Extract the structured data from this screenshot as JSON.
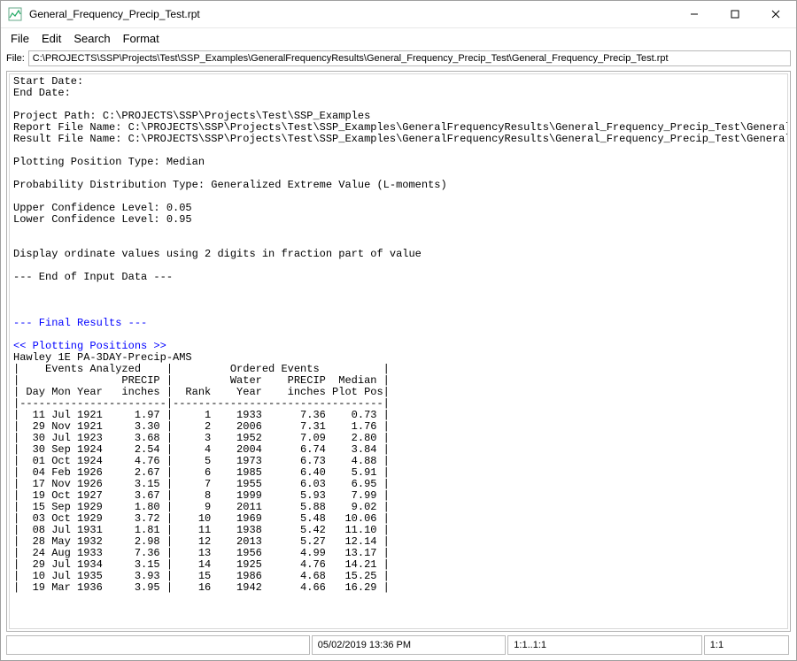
{
  "window": {
    "title": "General_Frequency_Precip_Test.rpt"
  },
  "menu": {
    "file": "File",
    "edit": "Edit",
    "search": "Search",
    "format": "Format"
  },
  "file_row": {
    "label": "File:",
    "path": "C:\\PROJECTS\\SSP\\Projects\\Test\\SSP_Examples\\GeneralFrequencyResults\\General_Frequency_Precip_Test\\General_Frequency_Precip_Test.rpt"
  },
  "report": {
    "start_date_label": "Start Date:",
    "end_date_label": "End Date:",
    "project_path_line": "Project Path: C:\\PROJECTS\\SSP\\Projects\\Test\\SSP_Examples",
    "report_file_line": "Report File Name: C:\\PROJECTS\\SSP\\Projects\\Test\\SSP_Examples\\GeneralFrequencyResults\\General_Frequency_Precip_Test\\General_Frequency_P",
    "result_file_line": "Result File Name: C:\\PROJECTS\\SSP\\Projects\\Test\\SSP_Examples\\GeneralFrequencyResults\\General_Frequency_Precip_Test\\General_Frequency_P",
    "plot_pos_line": "Plotting Position Type: Median",
    "dist_line": "Probability Distribution Type: Generalized Extreme Value (L-moments)",
    "ucl_line": "Upper Confidence Level: 0.05",
    "lcl_line": "Lower Confidence Level: 0.95",
    "digits_line": "Display ordinate values using 2 digits in fraction part of value",
    "end_input_line": "--- End of Input Data ---",
    "final_results_line": "--- Final Results ---",
    "plot_pos_header": "<< Plotting Positions >>",
    "series_name": "Hawley 1E PA-3DAY-Precip-AMS",
    "table_header1": "|    Events Analyzed    |         Ordered Events          |",
    "table_header2": "|                PRECIP |         Water    PRECIP  Median |",
    "table_header3": "| Day Mon Year   inches |  Rank    Year    inches Plot Pos|",
    "table_divider": "|-----------------------|---------------------------------|",
    "rows": [
      {
        "d": "11",
        "m": "Jul",
        "y": "1921",
        "v": "1.97",
        "r": "1",
        "wy": "1933",
        "ov": "7.36",
        "pp": "0.73"
      },
      {
        "d": "29",
        "m": "Nov",
        "y": "1921",
        "v": "3.30",
        "r": "2",
        "wy": "2006",
        "ov": "7.31",
        "pp": "1.76"
      },
      {
        "d": "30",
        "m": "Jul",
        "y": "1923",
        "v": "3.68",
        "r": "3",
        "wy": "1952",
        "ov": "7.09",
        "pp": "2.80"
      },
      {
        "d": "30",
        "m": "Sep",
        "y": "1924",
        "v": "2.54",
        "r": "4",
        "wy": "2004",
        "ov": "6.74",
        "pp": "3.84"
      },
      {
        "d": "01",
        "m": "Oct",
        "y": "1924",
        "v": "4.76",
        "r": "5",
        "wy": "1973",
        "ov": "6.73",
        "pp": "4.88"
      },
      {
        "d": "04",
        "m": "Feb",
        "y": "1926",
        "v": "2.67",
        "r": "6",
        "wy": "1985",
        "ov": "6.40",
        "pp": "5.91"
      },
      {
        "d": "17",
        "m": "Nov",
        "y": "1926",
        "v": "3.15",
        "r": "7",
        "wy": "1955",
        "ov": "6.03",
        "pp": "6.95"
      },
      {
        "d": "19",
        "m": "Oct",
        "y": "1927",
        "v": "3.67",
        "r": "8",
        "wy": "1999",
        "ov": "5.93",
        "pp": "7.99"
      },
      {
        "d": "15",
        "m": "Sep",
        "y": "1929",
        "v": "1.80",
        "r": "9",
        "wy": "2011",
        "ov": "5.88",
        "pp": "9.02"
      },
      {
        "d": "03",
        "m": "Oct",
        "y": "1929",
        "v": "3.72",
        "r": "10",
        "wy": "1969",
        "ov": "5.48",
        "pp": "10.06"
      },
      {
        "d": "08",
        "m": "Jul",
        "y": "1931",
        "v": "1.81",
        "r": "11",
        "wy": "1938",
        "ov": "5.42",
        "pp": "11.10"
      },
      {
        "d": "28",
        "m": "May",
        "y": "1932",
        "v": "2.98",
        "r": "12",
        "wy": "2013",
        "ov": "5.27",
        "pp": "12.14"
      },
      {
        "d": "24",
        "m": "Aug",
        "y": "1933",
        "v": "7.36",
        "r": "13",
        "wy": "1956",
        "ov": "4.99",
        "pp": "13.17"
      },
      {
        "d": "29",
        "m": "Jul",
        "y": "1934",
        "v": "3.15",
        "r": "14",
        "wy": "1925",
        "ov": "4.76",
        "pp": "14.21"
      },
      {
        "d": "10",
        "m": "Jul",
        "y": "1935",
        "v": "3.93",
        "r": "15",
        "wy": "1986",
        "ov": "4.68",
        "pp": "15.25"
      },
      {
        "d": "19",
        "m": "Mar",
        "y": "1936",
        "v": "3.95",
        "r": "16",
        "wy": "1942",
        "ov": "4.66",
        "pp": "16.29"
      }
    ]
  },
  "status": {
    "datetime": "05/02/2019 13:36 PM",
    "pos": "1:1..1:1",
    "mode": "1:1"
  },
  "icons": {
    "app": "app-icon",
    "min": "minimize-icon",
    "max": "maximize-icon",
    "close": "close-icon"
  }
}
